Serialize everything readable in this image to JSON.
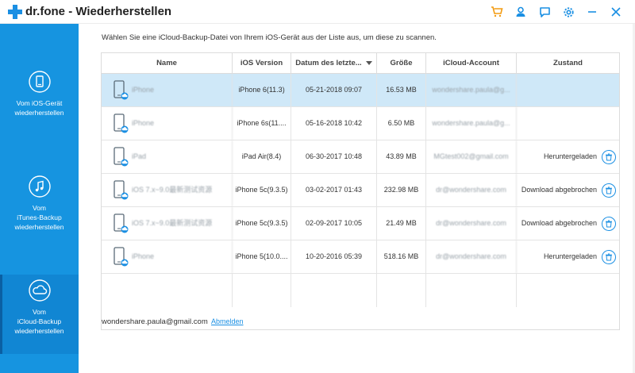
{
  "app": {
    "brand": "dr.fone",
    "title": "- Wiederherstellen"
  },
  "toolbar": {
    "icons": [
      "cart-icon",
      "user-icon",
      "feedback-icon",
      "settings-icon",
      "minimize-icon",
      "close-icon"
    ]
  },
  "sidebar": {
    "items": [
      {
        "label": "Vom iOS-Gerät wiederherstellen",
        "line1": "Vom iOS-Gerät",
        "line2": "wiederherstellen",
        "icon": "ios-device-icon"
      },
      {
        "label": "Vom iTunes-Backup wiederherstellen",
        "line1": "Vom",
        "line2": "iTunes-Backup",
        "line3": "wiederherstellen",
        "icon": "itunes-icon"
      },
      {
        "label": "Vom iCloud-Backup wiederherstellen",
        "line1": "Vom",
        "line2": "iCloud-Backup",
        "line3": "wiederherstellen",
        "icon": "icloud-icon"
      }
    ]
  },
  "main": {
    "instruction": "Wählen Sie eine iCloud-Backup-Datei von Ihrem iOS-Gerät aus der Liste aus, um diese zu scannen.",
    "columns": [
      "Name",
      "iOS Version",
      "Datum des letzte...",
      "Größe",
      "iCloud-Account",
      "Zustand"
    ],
    "rows": [
      {
        "name": "iPhone",
        "ios": "iPhone 6(11.3)",
        "date": "05-21-2018 09:07",
        "size": "16.53 MB",
        "account": "wondershare.paula@g...",
        "status": ""
      },
      {
        "name": "iPhone",
        "ios": "iPhone 6s(11....",
        "date": "05-16-2018 10:42",
        "size": "6.50 MB",
        "account": "wondershare.paula@g...",
        "status": ""
      },
      {
        "name": "iPad",
        "ios": "iPad Air(8.4)",
        "date": "06-30-2017 10:48",
        "size": "43.89 MB",
        "account": "MGtest002@gmail.com",
        "status": "Heruntergeladen"
      },
      {
        "name": "iOS 7.x~9.0最新测试资源",
        "ios": "iPhone 5c(9.3.5)",
        "date": "03-02-2017 01:43",
        "size": "232.98 MB",
        "account": "dr@wondershare.com",
        "status": "Download abgebrochen"
      },
      {
        "name": "iOS 7.x~9.0最新测试资源",
        "ios": "iPhone 5c(9.3.5)",
        "date": "02-09-2017 10:05",
        "size": "21.49 MB",
        "account": "dr@wondershare.com",
        "status": "Download abgebrochen"
      },
      {
        "name": "iPhone",
        "ios": "iPhone 5(10.0....",
        "date": "10-20-2016 05:39",
        "size": "518.16 MB",
        "account": "dr@wondershare.com",
        "status": "Heruntergeladen"
      }
    ],
    "selected_row": 0
  },
  "footer": {
    "email": "wondershare.paula@gmail.com",
    "logout": "Abmelden"
  },
  "colors": {
    "accent": "#1694e0",
    "selected_row": "#cfe8f8",
    "cart": "#f39c12"
  }
}
